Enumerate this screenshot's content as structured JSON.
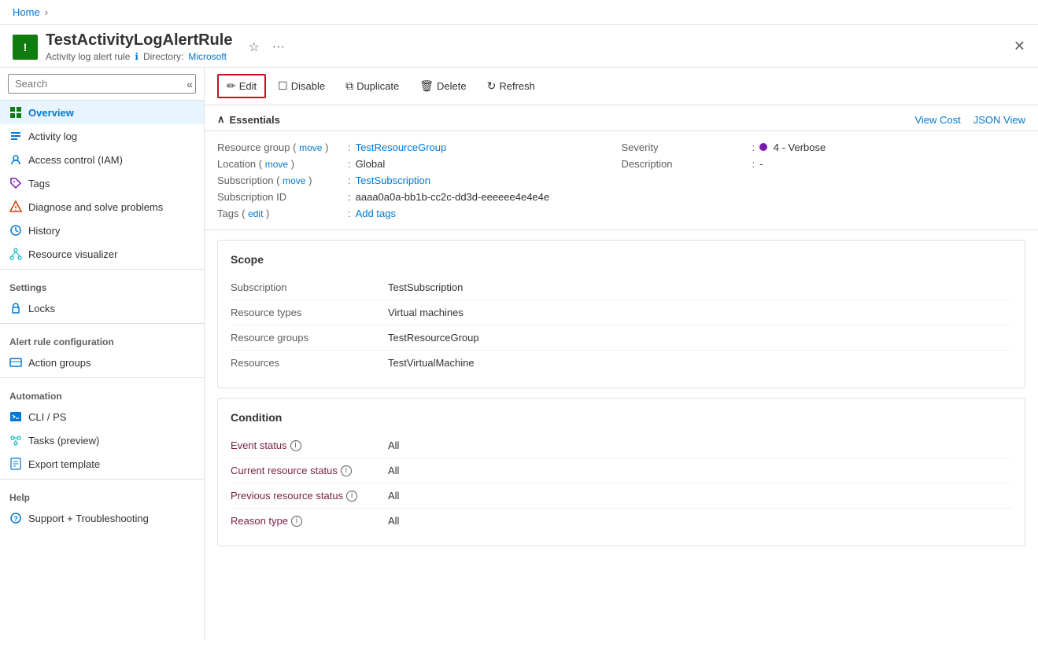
{
  "breadcrumb": {
    "home": "Home",
    "separator": "›"
  },
  "resource": {
    "title": "TestActivityLogAlertRule",
    "subtitle": "Activity log alert rule",
    "directory_label": "Directory:",
    "directory": "Microsoft",
    "icon_char": "!"
  },
  "toolbar": {
    "edit": "Edit",
    "disable": "Disable",
    "duplicate": "Duplicate",
    "delete": "Delete",
    "refresh": "Refresh"
  },
  "sidebar": {
    "search_placeholder": "Search",
    "items": [
      {
        "id": "overview",
        "label": "Overview",
        "active": true
      },
      {
        "id": "activity-log",
        "label": "Activity log",
        "active": false
      },
      {
        "id": "access-control",
        "label": "Access control (IAM)",
        "active": false
      },
      {
        "id": "tags",
        "label": "Tags",
        "active": false
      },
      {
        "id": "diagnose",
        "label": "Diagnose and solve problems",
        "active": false
      },
      {
        "id": "history",
        "label": "History",
        "active": false
      },
      {
        "id": "resource-visualizer",
        "label": "Resource visualizer",
        "active": false
      }
    ],
    "settings_label": "Settings",
    "settings_items": [
      {
        "id": "locks",
        "label": "Locks"
      }
    ],
    "alert_rule_label": "Alert rule configuration",
    "alert_rule_items": [
      {
        "id": "action-groups",
        "label": "Action groups"
      }
    ],
    "automation_label": "Automation",
    "automation_items": [
      {
        "id": "cli-ps",
        "label": "CLI / PS"
      },
      {
        "id": "tasks-preview",
        "label": "Tasks (preview)"
      },
      {
        "id": "export-template",
        "label": "Export template"
      }
    ],
    "help_label": "Help",
    "help_items": [
      {
        "id": "support",
        "label": "Support + Troubleshooting"
      }
    ]
  },
  "essentials": {
    "section_title": "Essentials",
    "view_cost": "View Cost",
    "json_view": "JSON View",
    "fields": {
      "resource_group_label": "Resource group",
      "resource_group_move": "move",
      "resource_group_value": "TestResourceGroup",
      "location_label": "Location",
      "location_move": "move",
      "location_value": "Global",
      "subscription_label": "Subscription",
      "subscription_move": "move",
      "subscription_value": "TestSubscription",
      "subscription_id_label": "Subscription ID",
      "subscription_id_value": "aaaa0a0a-bb1b-cc2c-dd3d-eeeeee4e4e4e",
      "tags_label": "Tags",
      "tags_edit": "edit",
      "tags_value": "Add tags",
      "severity_label": "Severity",
      "severity_value": "4 - Verbose",
      "description_label": "Description",
      "description_value": "-"
    }
  },
  "scope_card": {
    "title": "Scope",
    "rows": [
      {
        "label": "Subscription",
        "value": "TestSubscription"
      },
      {
        "label": "Resource types",
        "value": "Virtual machines"
      },
      {
        "label": "Resource groups",
        "value": "TestResourceGroup"
      },
      {
        "label": "Resources",
        "value": "TestVirtualMachine"
      }
    ]
  },
  "condition_card": {
    "title": "Condition",
    "rows": [
      {
        "label": "Event status",
        "has_info": true,
        "value": "All"
      },
      {
        "label": "Current resource status",
        "has_info": true,
        "value": "All"
      },
      {
        "label": "Previous resource status",
        "has_info": true,
        "value": "All"
      },
      {
        "label": "Reason type",
        "has_info": true,
        "value": "All"
      }
    ]
  }
}
